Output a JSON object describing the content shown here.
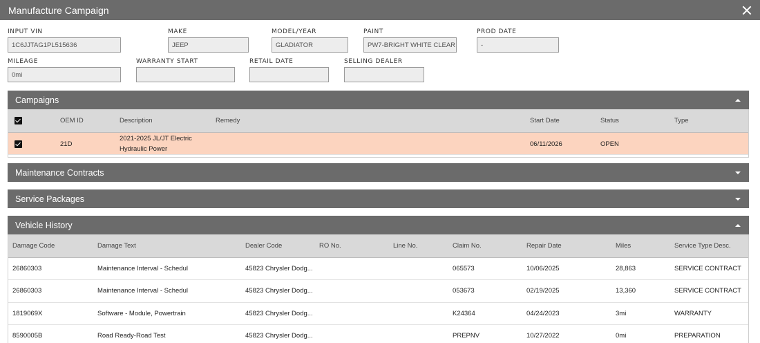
{
  "window": {
    "title": "Manufacture Campaign"
  },
  "fields": {
    "vin": {
      "label": "INPUT VIN",
      "value": "1C6JJTAG1PL515636"
    },
    "make": {
      "label": "MAKE",
      "value": "JEEP"
    },
    "model_year": {
      "label": "MODEL/YEAR",
      "value": "GLADIATOR"
    },
    "paint": {
      "label": "PAINT",
      "value": "PW7-BRIGHT WHITE CLEAR"
    },
    "prod_date": {
      "label": "PROD DATE",
      "value": "-"
    },
    "mileage": {
      "label": "MILEAGE",
      "value": "0mi"
    },
    "warranty_start": {
      "label": "WARRANTY START",
      "value": ""
    },
    "retail_date": {
      "label": "RETAIL DATE",
      "value": ""
    },
    "selling_dealer": {
      "label": "SELLING DEALER",
      "value": ""
    }
  },
  "campaigns": {
    "title": "Campaigns",
    "columns": [
      "OEM ID",
      "Description",
      "Remedy",
      "Start Date",
      "Status",
      "Type"
    ],
    "rows": [
      {
        "oem_id": "21D",
        "description_line1": "2021-2025 JL/JT Electric",
        "description_line2": "Hydraulic Power",
        "remedy": "",
        "start_date": "06/11/2026",
        "status": "OPEN",
        "type": ""
      }
    ],
    "highlight_color": "#fcd4bf"
  },
  "maintenance_contracts": {
    "title": "Maintenance Contracts"
  },
  "service_packages": {
    "title": "Service Packages"
  },
  "vehicle_history": {
    "title": "Vehicle History",
    "columns": [
      "Damage Code",
      "Damage Text",
      "Dealer Code",
      "RO No.",
      "Line No.",
      "Claim No.",
      "Repair Date",
      "Miles",
      "Service Type Desc."
    ],
    "rows": [
      {
        "damage_code": "26860303",
        "damage_text": "Maintenance Interval - Schedul",
        "dealer_code": "45823 Chrysler Dodg...",
        "ro_no": "",
        "line_no": "",
        "claim_no": "065573",
        "repair_date": "10/06/2025",
        "miles": "28,863",
        "service_type": "SERVICE CONTRACT"
      },
      {
        "damage_code": "26860303",
        "damage_text": "Maintenance Interval - Schedul",
        "dealer_code": "45823 Chrysler Dodg...",
        "ro_no": "",
        "line_no": "",
        "claim_no": "053673",
        "repair_date": "02/19/2025",
        "miles": "13,360",
        "service_type": "SERVICE CONTRACT"
      },
      {
        "damage_code": "1819069X",
        "damage_text": "Software - Module, Powertrain",
        "dealer_code": "45823 Chrysler Dodg...",
        "ro_no": "",
        "line_no": "",
        "claim_no": "K24364",
        "repair_date": "04/24/2023",
        "miles": "3mi",
        "service_type": "WARRANTY"
      },
      {
        "damage_code": "8590005B",
        "damage_text": "Road Ready-Road Test",
        "dealer_code": "45823 Chrysler Dodg...",
        "ro_no": "",
        "line_no": "",
        "claim_no": "PREPNV",
        "repair_date": "10/27/2022",
        "miles": "0mi",
        "service_type": "PREPARATION"
      }
    ]
  }
}
